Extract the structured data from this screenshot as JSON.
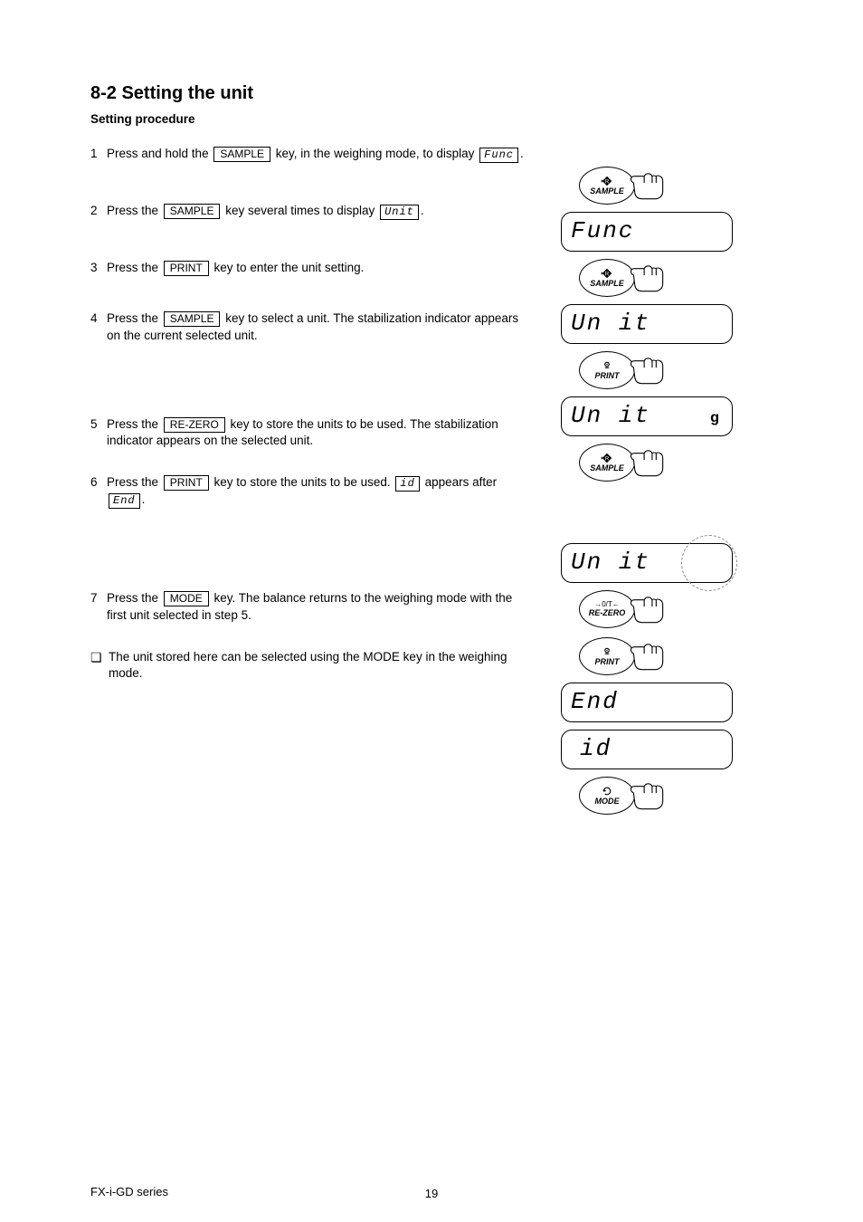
{
  "title": "8-2 Setting the unit",
  "subtitle": "Setting procedure",
  "steps": [
    {
      "num": "1",
      "text_a": "Press and hold the ",
      "btn": "SAMPLE ",
      "text_b": " key, in the weighing mode, to display ",
      "seg": "Func",
      "text_c": "."
    },
    {
      "num": "2",
      "text_a": "Press the ",
      "btn": "SAMPLE",
      "text_b": " key several times to display ",
      "seg": "Unit",
      "text_c": "."
    },
    {
      "num": "3",
      "text_a": "Press the ",
      "btn": "PRINT",
      "text_b": " key to enter the unit setting."
    },
    {
      "num": "4",
      "text_a": "Press the ",
      "btn": "SAMPLE",
      "text_b": " key to select a unit. The stabilization indicator appears on the current selected unit."
    },
    {
      "num": "5",
      "text_a": "Press the ",
      "btn": "RE-ZERO",
      "text_b": " key to store the units to be used. The stabilization indicator appears on the selected unit."
    },
    {
      "num": "6",
      "text_a": "Press the ",
      "btn": "PRINT",
      "text_b": " key to store the units to be used. ",
      "seg": "id",
      "text_c": " appears after ",
      "seg2": "End",
      "text_d": "."
    },
    {
      "num": "7",
      "text_a": "Press the ",
      "btn": "MODE",
      "text_b": " key. The balance returns to the weighing mode with the first unit selected in step 5."
    }
  ],
  "bullet": "The unit stored here can be selected using the MODE key in the weighing mode.",
  "right": {
    "displays": {
      "func": "Func",
      "unit": "Un it",
      "unit_g": "Un it",
      "unit_g_label": "g",
      "end": "End",
      "id": "id"
    },
    "keys": {
      "sample": {
        "top": "R",
        "label": "SAMPLE"
      },
      "print": {
        "top": "⦿",
        "label": "PRINT"
      },
      "rezero": {
        "top": "→0/T←",
        "label": "RE-ZERO"
      },
      "mode": {
        "top": "↻",
        "label": "MODE"
      }
    }
  },
  "page_number": "19",
  "doc_id": "FX-i-GD series"
}
